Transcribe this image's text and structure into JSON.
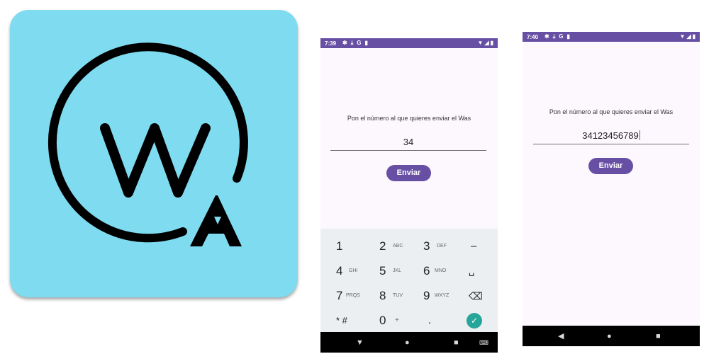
{
  "phone1": {
    "status_time": "7:39",
    "status_icons": [
      "settings-icon",
      "download-icon",
      "google-icon",
      "sdcard-icon"
    ],
    "prompt": "Pon el número al que quieres enviar el Was",
    "number_value": "34",
    "send_label": "Enviar",
    "keypad": {
      "keys": [
        {
          "digit": "1",
          "letters": ""
        },
        {
          "digit": "2",
          "letters": "ABC"
        },
        {
          "digit": "3",
          "letters": "DEF"
        },
        {
          "digit": "–",
          "letters": ""
        },
        {
          "digit": "4",
          "letters": "GHI"
        },
        {
          "digit": "5",
          "letters": "JKL"
        },
        {
          "digit": "6",
          "letters": "MNO"
        },
        {
          "digit": "␣",
          "letters": ""
        },
        {
          "digit": "7",
          "letters": "PRQS"
        },
        {
          "digit": "8",
          "letters": "TUV"
        },
        {
          "digit": "9",
          "letters": "WXYZ"
        },
        {
          "digit": "⌫",
          "letters": ""
        },
        {
          "digit": "* #",
          "letters": ""
        },
        {
          "digit": "0",
          "letters": "+"
        },
        {
          "digit": ".",
          "letters": ""
        },
        {
          "digit": "✓",
          "letters": ""
        }
      ]
    }
  },
  "phone2": {
    "status_time": "7:40",
    "prompt": "Pon el número al que quieres enviar el Was",
    "number_value": "34123456789",
    "send_label": "Enviar"
  },
  "nav": {
    "back": "◀",
    "home": "●",
    "recents": "■",
    "keyboard": "⌨",
    "back_down": "▼"
  },
  "colors": {
    "icon_bg": "#7fdbef",
    "accent": "#6750a4",
    "confirm": "#26a69a"
  }
}
